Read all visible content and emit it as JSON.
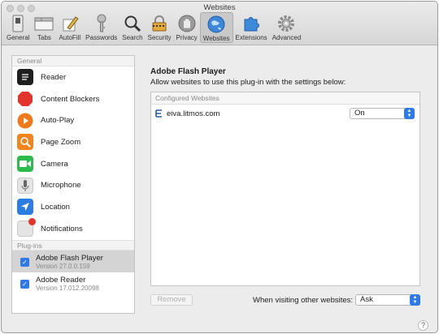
{
  "window": {
    "title": "Websites"
  },
  "toolbar": {
    "items": [
      {
        "label": "General",
        "icon": "switch-icon"
      },
      {
        "label": "Tabs",
        "icon": "tabs-icon"
      },
      {
        "label": "AutoFill",
        "icon": "pencil-icon"
      },
      {
        "label": "Passwords",
        "icon": "key-icon"
      },
      {
        "label": "Search",
        "icon": "magnifier-icon"
      },
      {
        "label": "Security",
        "icon": "padlock-icon"
      },
      {
        "label": "Privacy",
        "icon": "hand-icon"
      },
      {
        "label": "Websites",
        "icon": "globe-icon",
        "active": true
      },
      {
        "label": "Extensions",
        "icon": "puzzle-icon"
      },
      {
        "label": "Advanced",
        "icon": "gear-icon"
      }
    ]
  },
  "sidebar": {
    "general_header": "General",
    "items": [
      {
        "label": "Reader",
        "icon": "reader-icon"
      },
      {
        "label": "Content Blockers",
        "icon": "stop-sign-icon"
      },
      {
        "label": "Auto-Play",
        "icon": "play-icon"
      },
      {
        "label": "Page Zoom",
        "icon": "zoom-icon"
      },
      {
        "label": "Camera",
        "icon": "camera-icon"
      },
      {
        "label": "Microphone",
        "icon": "microphone-icon"
      },
      {
        "label": "Location",
        "icon": "location-arrow-icon"
      },
      {
        "label": "Notifications",
        "icon": "notification-icon"
      }
    ],
    "plugins_header": "Plug-ins",
    "plugins": [
      {
        "name": "Adobe Flash Player",
        "version": "Version 27.0.0.159",
        "checked": true,
        "selected": true
      },
      {
        "name": "Adobe Reader",
        "version": "Version 17.012.20098",
        "checked": true,
        "selected": false
      }
    ]
  },
  "panel": {
    "title": "Adobe Flash Player",
    "description": "Allow websites to use this plug-in with the settings below:",
    "configured_header": "Configured Websites",
    "sites": [
      {
        "domain": "eiva.litmos.com",
        "setting": "On"
      }
    ],
    "remove_label": "Remove",
    "other_label": "When visiting other websites:",
    "other_value": "Ask"
  },
  "help_label": "?",
  "colors": {
    "accent": "#2f7ae5",
    "selected_row": "#d4d4d4"
  }
}
